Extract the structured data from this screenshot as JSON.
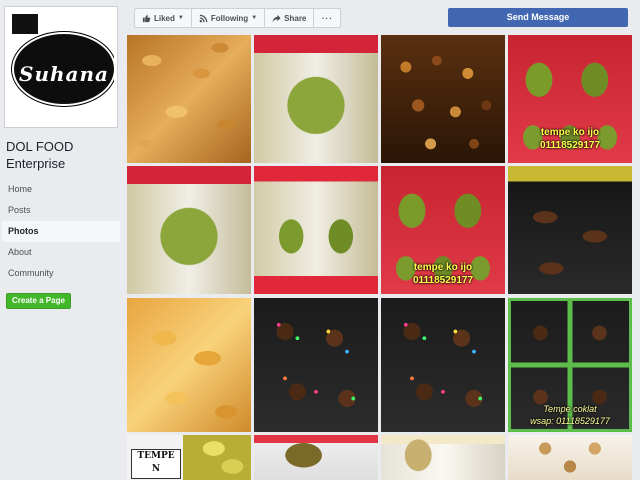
{
  "profile": {
    "logo_text": "Suhana",
    "page_name_line1": "DOL FOOD",
    "page_name_line2": "Enterprise"
  },
  "nav": {
    "items": [
      {
        "label": "Home"
      },
      {
        "label": "Posts"
      },
      {
        "label": "Photos",
        "active": true
      },
      {
        "label": "About"
      },
      {
        "label": "Community"
      }
    ],
    "create_page_label": "Create a Page"
  },
  "header": {
    "liked_label": "Liked",
    "following_label": "Following",
    "share_label": "Share",
    "more_label": "···",
    "send_message_label": "Send Message"
  },
  "photos": {
    "captions": {
      "green_jars_1_line1": "tempe ko ijo",
      "green_jars_1_line2": "01118529177",
      "green_jars_2_line1": "tempe ko ijo",
      "green_jars_2_line2": "01118529177",
      "choc_grid_line1": "Tempe coklat",
      "choc_grid_line2": "wsap: 01118529177",
      "tempe_label": "TEMPE N"
    }
  },
  "colors": {
    "accent_blue": "#4267b2",
    "create_green": "#42b72a",
    "caption_yellow": "#ffff4d",
    "background": "#e9ebee"
  },
  "icons": {
    "liked": "thumbs-up-icon",
    "following": "rss-icon",
    "share": "share-arrow-icon"
  }
}
